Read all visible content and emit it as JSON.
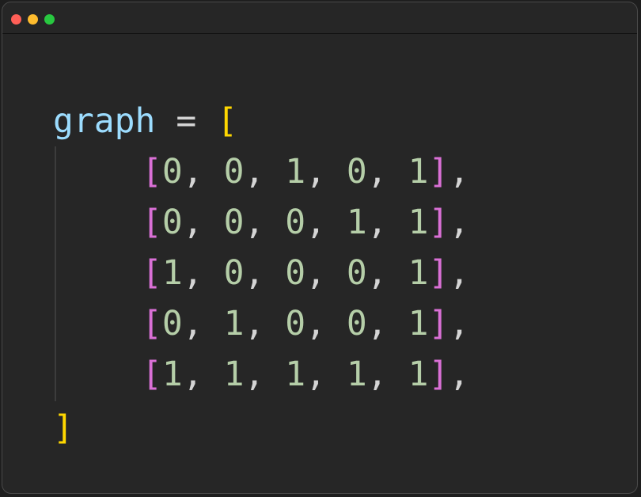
{
  "window": {
    "controls": [
      {
        "name": "close",
        "color": "#ff5f57"
      },
      {
        "name": "minimize",
        "color": "#febc2e"
      },
      {
        "name": "maximize",
        "color": "#28c840"
      }
    ]
  },
  "colors": {
    "variable": "#9cdcfe",
    "operator": "#d4d4d4",
    "outer_bracket": "#ffd700",
    "inner_bracket": "#da70d6",
    "number": "#b5cea8",
    "punctuation": "#d4d4d4"
  },
  "code": {
    "first_line": {
      "variable": "graph",
      "operator": " = ",
      "open_bracket": "["
    },
    "rows": [
      {
        "open": "[",
        "values": [
          "0",
          "0",
          "1",
          "0",
          "1"
        ],
        "close": "]",
        "trail": ","
      },
      {
        "open": "[",
        "values": [
          "0",
          "0",
          "0",
          "1",
          "1"
        ],
        "close": "]",
        "trail": ","
      },
      {
        "open": "[",
        "values": [
          "1",
          "0",
          "0",
          "0",
          "1"
        ],
        "close": "]",
        "trail": ","
      },
      {
        "open": "[",
        "values": [
          "0",
          "1",
          "0",
          "0",
          "1"
        ],
        "close": "]",
        "trail": ","
      },
      {
        "open": "[",
        "values": [
          "1",
          "1",
          "1",
          "1",
          "1"
        ],
        "close": "]",
        "trail": ","
      }
    ],
    "last_line": {
      "close_bracket": "]"
    }
  }
}
